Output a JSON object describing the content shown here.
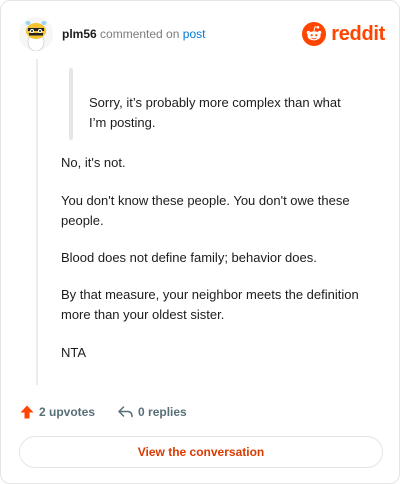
{
  "header": {
    "username": "plm56",
    "action_text": "commented on",
    "target_link": "post",
    "brand_name": "reddit"
  },
  "comment": {
    "quote": "Sorry, it’s probably more complex than what I’m posting.",
    "paragraphs": [
      "No, it's not.",
      "You don't know these people. You don't owe these people.",
      "Blood does not define family; behavior does.",
      "By that measure, your neighbor meets the definition more than your oldest sister.",
      "NTA"
    ]
  },
  "actions": {
    "upvotes": "2 upvotes",
    "replies": "0 replies"
  },
  "cta": {
    "label": "View the conversation"
  },
  "colors": {
    "brand": "#ff4500",
    "link": "#0079d3",
    "cta_text": "#d93a00",
    "upvote": "#ff4500"
  },
  "icons": {
    "avatar": "snoo-avatar",
    "brand": "reddit-snoo-icon",
    "upvote": "upvote-arrow-icon",
    "reply": "reply-arrow-icon"
  }
}
